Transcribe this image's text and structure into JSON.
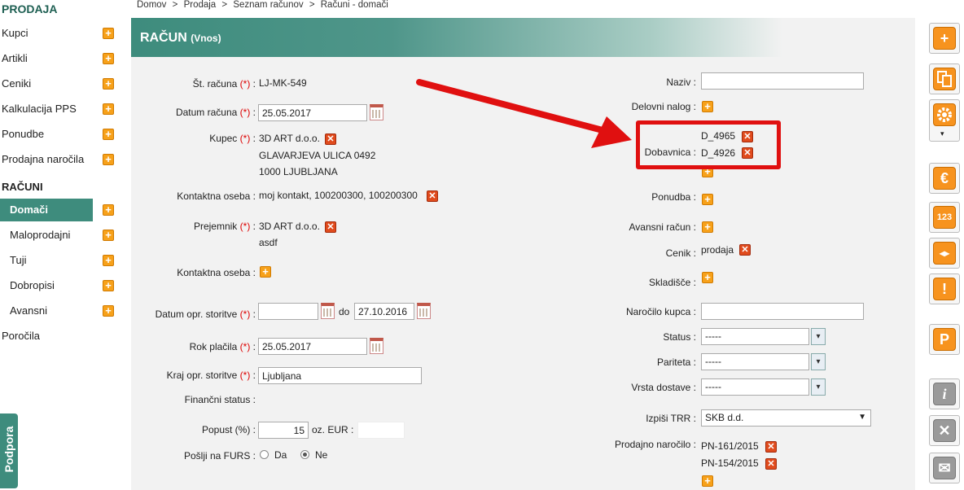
{
  "sidebar": {
    "section_prodaja": "PRODAJA",
    "items_prodaja": [
      {
        "label": "Kupci"
      },
      {
        "label": "Artikli"
      },
      {
        "label": "Ceniki"
      },
      {
        "label": "Kalkulacija PPS"
      },
      {
        "label": "Ponudbe"
      },
      {
        "label": "Prodajna naročila"
      }
    ],
    "section_racuni": "RAČUNI",
    "items_racuni": [
      {
        "label": "Domači"
      },
      {
        "label": "Maloprodajni"
      },
      {
        "label": "Tuji"
      },
      {
        "label": "Dobropisi"
      },
      {
        "label": "Avansni"
      }
    ],
    "porocila": "Poročila",
    "podpora": "Podpora"
  },
  "breadcrumb": [
    "Domov",
    ">",
    "Prodaja",
    ">",
    "Seznam računov",
    ">",
    "Računi - domači"
  ],
  "header": {
    "title": "RAČUN",
    "subtitle": "(Vnos)"
  },
  "req_mark": "(*)",
  "left": {
    "st_racuna": {
      "label": "Št. računa",
      "value": "LJ-MK-549"
    },
    "datum_racuna": {
      "label": "Datum računa",
      "value": "25.05.2017"
    },
    "kupec": {
      "label": "Kupec",
      "name": "3D ART d.o.o.",
      "street": "GLAVARJEVA ULICA 0492",
      "city": "1000 LJUBLJANA"
    },
    "kontaktna_oseba_1": {
      "label": "Kontaktna oseba :",
      "value": "moj kontakt, 100200300, 100200300"
    },
    "prejemnik": {
      "label": "Prejemnik",
      "name": "3D ART d.o.o.",
      "note": "asdf"
    },
    "kontaktna_oseba_2": {
      "label": "Kontaktna oseba :"
    },
    "datum_opr": {
      "label": "Datum opr. storitve",
      "from": "",
      "do_label": "do",
      "to": "27.10.2016"
    },
    "rok_placila": {
      "label": "Rok plačila",
      "value": "25.05.2017"
    },
    "kraj_opr": {
      "label": "Kraj opr. storitve",
      "value": "Ljubljana"
    },
    "financni_status": {
      "label": "Finančni status :"
    },
    "popust": {
      "label": "Popust (%) :",
      "value": "15",
      "eur_label": "oz. EUR :",
      "eur_value": ""
    },
    "poslji_furs": {
      "label": "Pošlji na FURS :",
      "opt_da": "Da",
      "opt_ne": "Ne",
      "selected": "Ne"
    }
  },
  "right": {
    "naziv": {
      "label": "Naziv :",
      "value": ""
    },
    "delovni_nalog": {
      "label": "Delovni nalog :"
    },
    "dobavnica": {
      "label": "Dobavnica :",
      "items": [
        "D_4965",
        "D_4926"
      ]
    },
    "ponudba": {
      "label": "Ponudba :"
    },
    "avansni_racun": {
      "label": "Avansni račun :"
    },
    "cenik": {
      "label": "Cenik :",
      "value": "prodaja"
    },
    "skladisce": {
      "label": "Skladišče :"
    },
    "narocilo_kupca": {
      "label": "Naročilo kupca :",
      "value": ""
    },
    "status": {
      "label": "Status :",
      "value": "-----"
    },
    "pariteta": {
      "label": "Pariteta :",
      "value": "-----"
    },
    "vrsta_dostave": {
      "label": "Vrsta dostave :",
      "value": "-----"
    },
    "izpisi_trr": {
      "label": "Izpiši TRR :",
      "value": "SKB d.d."
    },
    "prodajno_narocilo": {
      "label": "Prodajno naročilo :",
      "items": [
        "PN-161/2015",
        "PN-154/2015"
      ]
    }
  },
  "toolbar_icons": [
    "plus-icon",
    "copy-icon",
    "gear-icon",
    "euro-icon",
    "numbers-icon",
    "split-icon",
    "warning-icon",
    "p-icon",
    "info-icon",
    "close-icon",
    "mail-icon"
  ],
  "glyphs": {
    "plus": "+",
    "x": "✕",
    "caret": "▾",
    "euro": "€",
    "num": "123",
    "split": "◂▸",
    "warn": "!",
    "p": "P",
    "info": "i",
    "mail": "✉",
    "dropdown": "▼"
  },
  "colors": {
    "accent": "#3e8c7d",
    "orange": "#f7931e",
    "red": "#e01010"
  }
}
